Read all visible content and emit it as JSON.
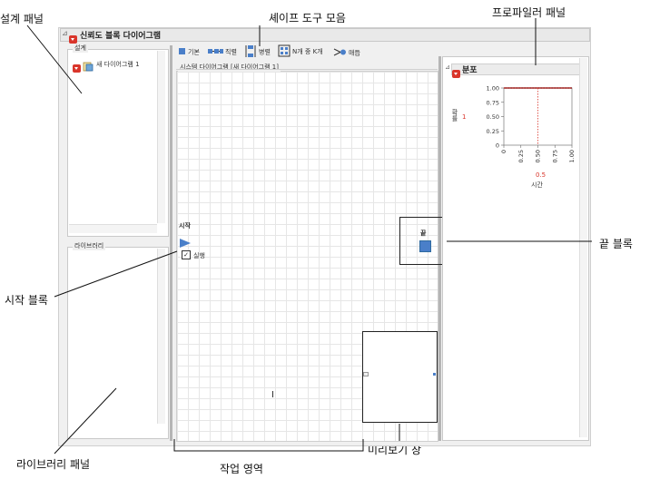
{
  "callouts": {
    "design_panel": "설계 패널",
    "shape_toolbar": "셰이프 도구 모음",
    "profiler_panel": "프로파일러 패널",
    "end_block": "끝 블록",
    "start_block": "시작 블록",
    "library_panel": "라이브러리 패널",
    "work_area": "작업 영역",
    "preview_window": "미리보기 창"
  },
  "window": {
    "title": "신뢰도 블록 다이어그램"
  },
  "design": {
    "group_label": "설계",
    "item_label": "새 다이어그램 1"
  },
  "library": {
    "group_label": "라이브러리"
  },
  "toolbar": {
    "basic": "기본",
    "series": "직렬",
    "parallel": "병렬",
    "k_of_n": "N개 중 K개",
    "knot": "매듭"
  },
  "workspace": {
    "group_label": "시스템 다이어그램 [새 다이어그램 1]",
    "start_label": "시작",
    "run_label": "실행",
    "end_label": "끝"
  },
  "distribution": {
    "title": "분포",
    "y_axis_label": "확률",
    "y_marker": "1",
    "x_axis_label": "시간",
    "x_marker": "0.5"
  },
  "chart_data": {
    "type": "line",
    "series": [
      {
        "x": [
          0,
          0.25,
          0.5,
          0.75,
          1.0
        ],
        "y": [
          1.0,
          1.0,
          1.0,
          1.0,
          1.0
        ]
      }
    ],
    "xlabel": "시간",
    "ylabel": "확률",
    "xlim": [
      0,
      1.0
    ],
    "ylim": [
      0,
      1.0
    ],
    "x_ticks": [
      "0",
      "0.25",
      "0.50",
      "0.75",
      "1.00"
    ],
    "y_ticks": [
      "0",
      "0.25",
      "0.50",
      "0.75",
      "1.00"
    ],
    "crosshair": {
      "x": 0.5,
      "y": 1.0
    },
    "colors": {
      "line": "#d9352b"
    }
  }
}
